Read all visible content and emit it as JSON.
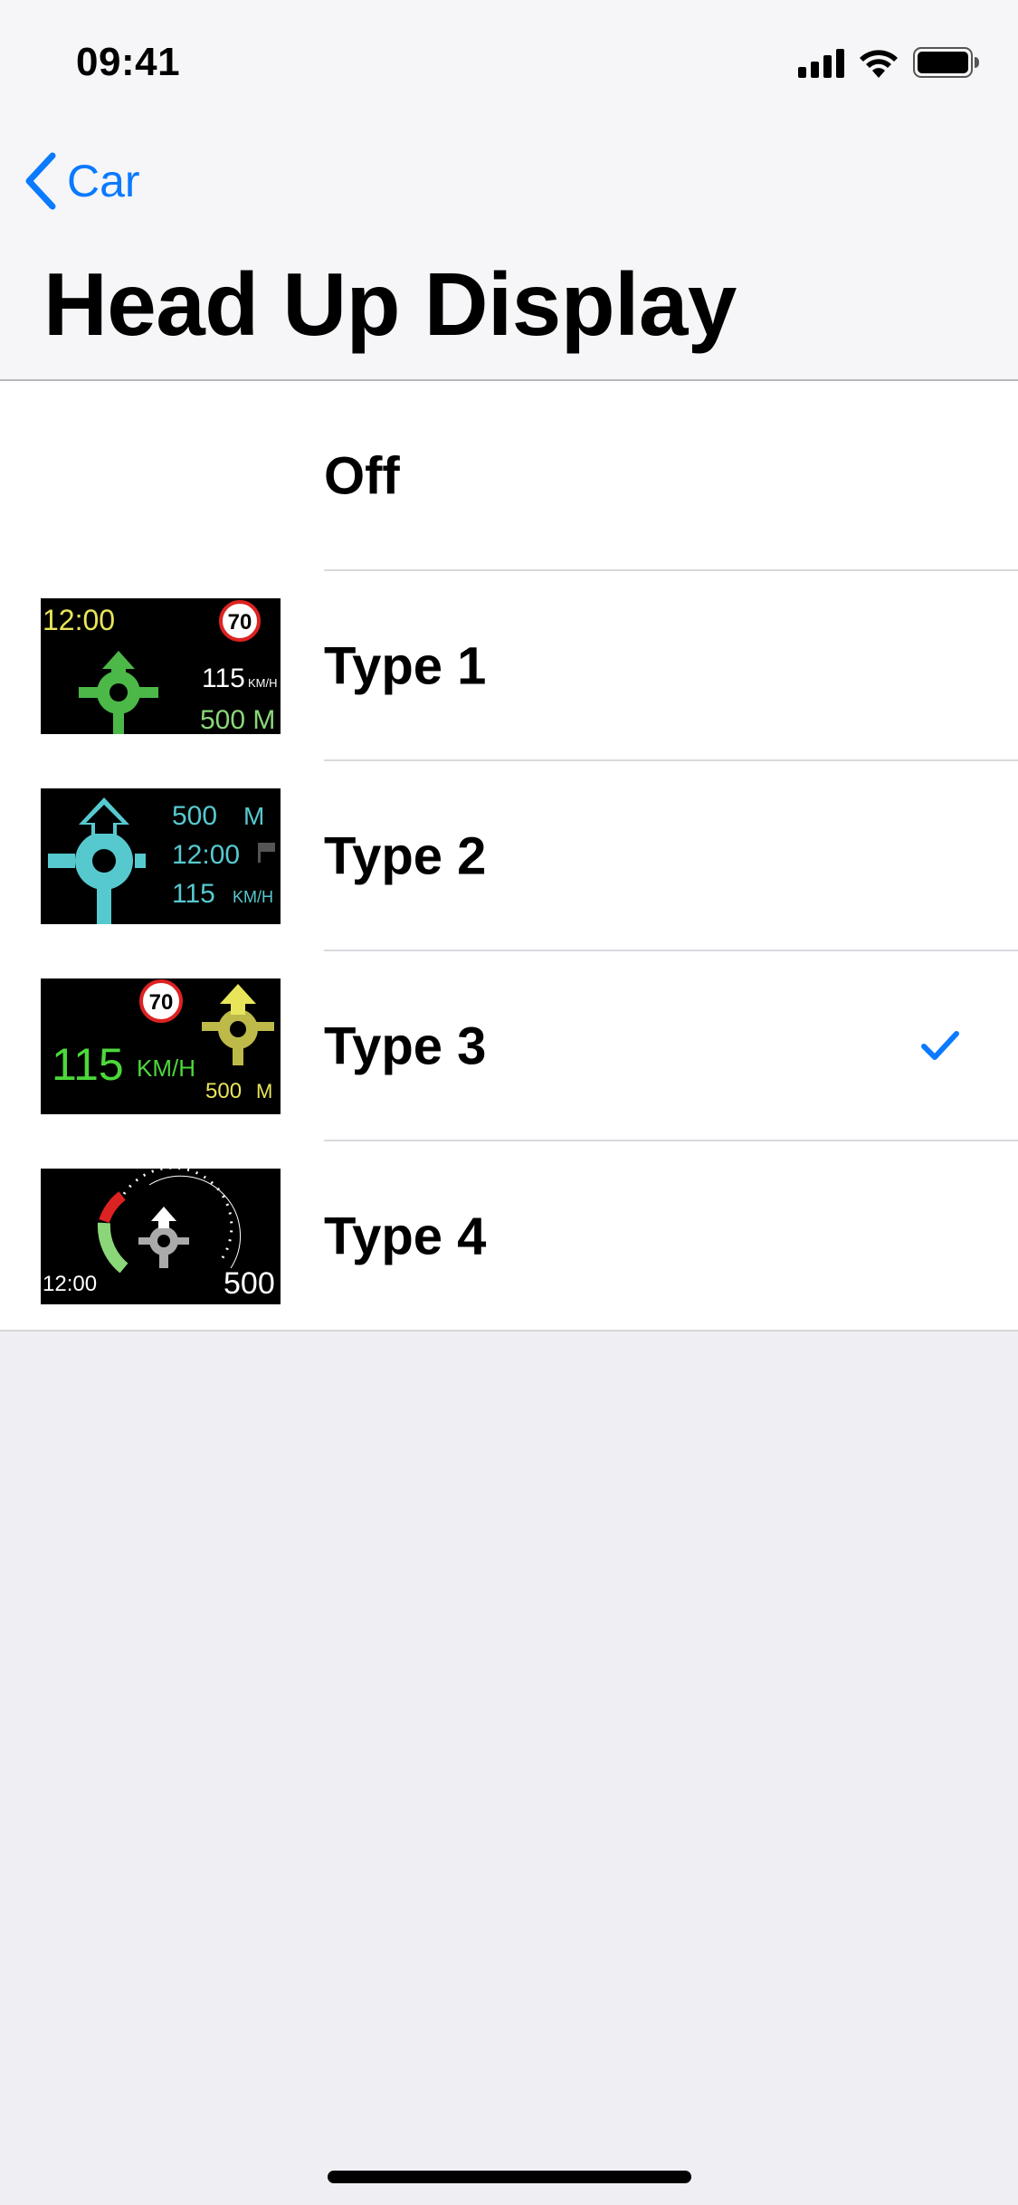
{
  "status": {
    "time": "09:41"
  },
  "nav": {
    "back_label": "Car",
    "title": "Head Up Display"
  },
  "options": [
    {
      "label": "Off",
      "selected": false
    },
    {
      "label": "Type 1",
      "selected": false
    },
    {
      "label": "Type 2",
      "selected": false
    },
    {
      "label": "Type 3",
      "selected": true
    },
    {
      "label": "Type 4",
      "selected": false
    }
  ],
  "thumbnails": {
    "type1": {
      "time": "12:00",
      "speed_limit": "70",
      "speed": "115",
      "speed_unit": "KM/H",
      "distance": "500 M"
    },
    "type2": {
      "distance": "500",
      "distance_unit": "M",
      "time": "12:00",
      "speed": "115",
      "speed_unit": "KM/H"
    },
    "type3": {
      "speed_limit": "70",
      "speed": "115",
      "speed_unit": "KM/H",
      "distance": "500",
      "distance_unit": "M"
    },
    "type4": {
      "time": "12:00",
      "distance": "500"
    }
  },
  "colors": {
    "accent": "#0A7AFF",
    "hud_green": "#4CB848",
    "hud_cyan": "#56C9CF",
    "hud_yellow": "#E8E55A",
    "hud_olive": "#BDBA4A"
  }
}
